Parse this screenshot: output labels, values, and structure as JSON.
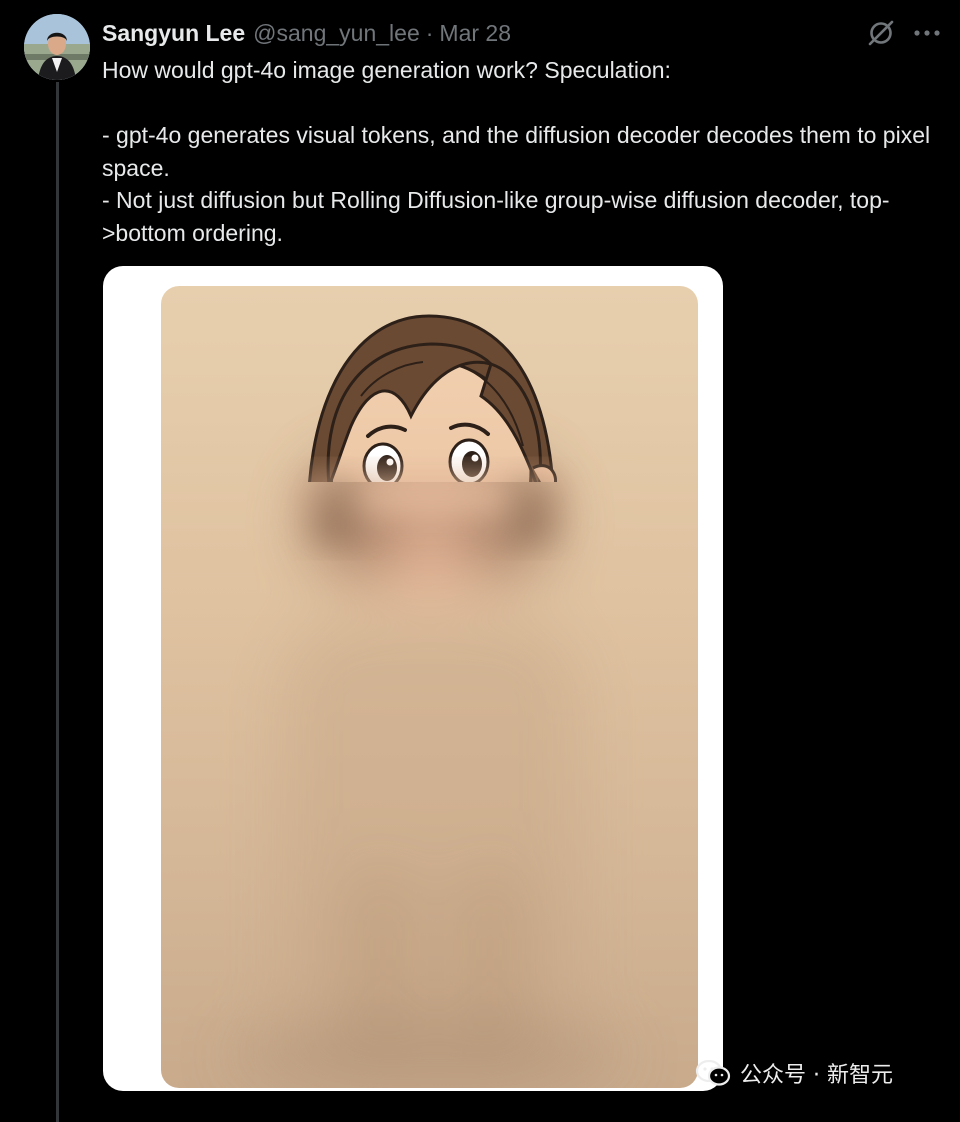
{
  "tweet": {
    "author_name": "Sangyun Lee",
    "handle": "@sang_yun_lee",
    "separator": "·",
    "date": "Mar 28",
    "text_lines": [
      "How would gpt-4o image generation work? Speculation:",
      "- gpt-4o generates visual tokens, and the diffusion decoder decodes them to pixel space.",
      "- Not just diffusion but Rolling Diffusion-like group-wise diffusion decoder, top->bottom ordering."
    ]
  },
  "icons": {
    "grok": "grok-icon",
    "more": "more-icon",
    "watermark": "wechat-icon"
  },
  "watermark": {
    "text": "公众号 · 新智元"
  },
  "colors": {
    "background": "#000000",
    "primary_text": "#e7e9ea",
    "secondary_text": "#71767b",
    "card_background": "#ffffff",
    "image_background": "#e3c8a6"
  }
}
